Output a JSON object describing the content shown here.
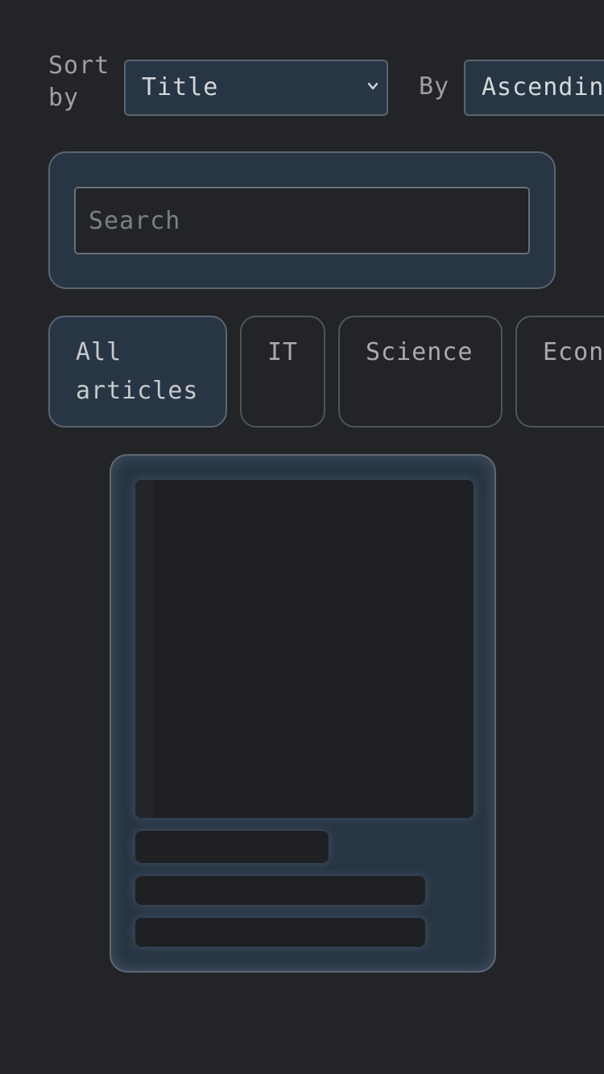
{
  "sort": {
    "label": "Sort by",
    "field_value": "Title",
    "by_label": "By",
    "order_value": "Ascending"
  },
  "search": {
    "placeholder": "Search"
  },
  "categories": [
    {
      "label": "All articles",
      "active": true
    },
    {
      "label": "IT",
      "active": false
    },
    {
      "label": "Science",
      "active": false
    },
    {
      "label": "Economics",
      "active": false
    }
  ],
  "colors": {
    "background": "#232427",
    "panel": "#283544",
    "border": "#5b6571",
    "skeleton": "#1f2023"
  }
}
